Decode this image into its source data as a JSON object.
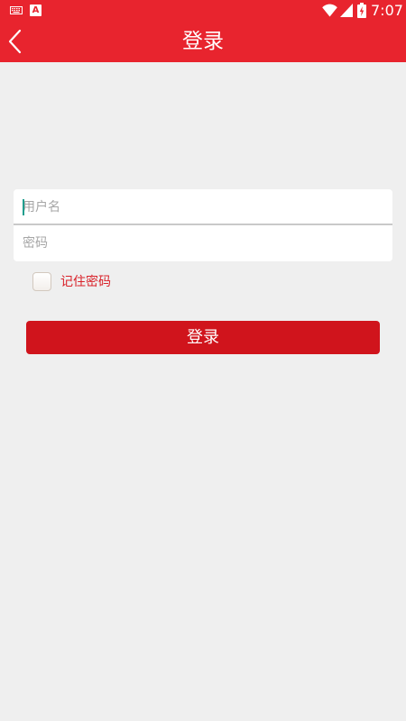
{
  "status_bar": {
    "icons": [
      "keyboard-icon",
      "font-a-icon",
      "wifi-icon",
      "signal-icon",
      "battery-charging-icon"
    ],
    "a_badge": "A",
    "time": "7:07"
  },
  "header": {
    "title": "登录",
    "back_icon": "chevron-left-icon",
    "background": "#e8242e"
  },
  "form": {
    "username": {
      "value": "",
      "placeholder": "用户名"
    },
    "password": {
      "value": "",
      "placeholder": "密码"
    },
    "remember": {
      "label": "记住密码",
      "checked": false
    }
  },
  "login_button": {
    "label": "登录",
    "background": "#d0141c"
  },
  "colors": {
    "page_background": "#efefef",
    "accent_text": "#d9222a",
    "caret": "#1f9e8e"
  }
}
